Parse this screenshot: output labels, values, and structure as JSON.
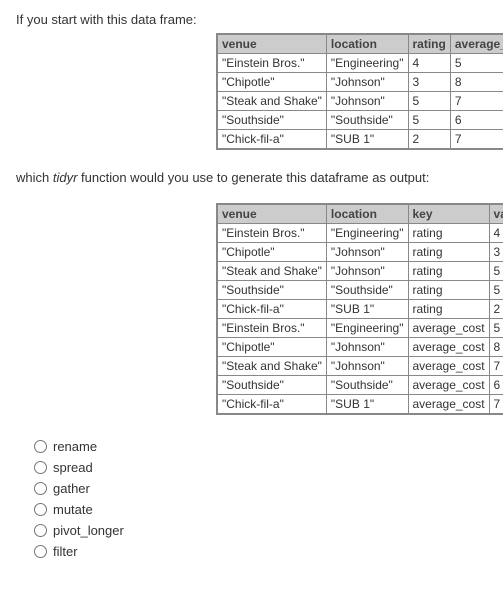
{
  "intro": "If you start with this data frame:",
  "mid_text_before": "which ",
  "mid_text_em": "tidyr",
  "mid_text_after": " function would you use to generate this dataframe as output:",
  "table1": {
    "headers": [
      "venue",
      "location",
      "rating",
      "average_cost"
    ],
    "rows": [
      [
        "\"Einstein Bros.\"",
        "\"Engineering\"",
        "4",
        "5"
      ],
      [
        "\"Chipotle\"",
        "\"Johnson\"",
        "3",
        "8"
      ],
      [
        "\"Steak and Shake\"",
        "\"Johnson\"",
        "5",
        "7"
      ],
      [
        "\"Southside\"",
        "\"Southside\"",
        "5",
        "6"
      ],
      [
        "\"Chick-fil-a\"",
        "\"SUB 1\"",
        "2",
        "7"
      ]
    ]
  },
  "table2": {
    "headers": [
      "venue",
      "location",
      "key",
      "value"
    ],
    "rows": [
      [
        "\"Einstein Bros.\"",
        "\"Engineering\"",
        "rating",
        "4"
      ],
      [
        "\"Chipotle\"",
        "\"Johnson\"",
        "rating",
        "3"
      ],
      [
        "\"Steak and Shake\"",
        "\"Johnson\"",
        "rating",
        "5"
      ],
      [
        "\"Southside\"",
        "\"Southside\"",
        "rating",
        "5"
      ],
      [
        "\"Chick-fil-a\"",
        "\"SUB 1\"",
        "rating",
        "2"
      ],
      [
        "\"Einstein Bros.\"",
        "\"Engineering\"",
        "average_cost",
        "5"
      ],
      [
        "\"Chipotle\"",
        "\"Johnson\"",
        "average_cost",
        "8"
      ],
      [
        "\"Steak and Shake\"",
        "\"Johnson\"",
        "average_cost",
        "7"
      ],
      [
        "\"Southside\"",
        "\"Southside\"",
        "average_cost",
        "6"
      ],
      [
        "\"Chick-fil-a\"",
        "\"SUB 1\"",
        "average_cost",
        "7"
      ]
    ]
  },
  "options": [
    "rename",
    "spread",
    "gather",
    "mutate",
    "pivot_longer",
    "filter"
  ]
}
